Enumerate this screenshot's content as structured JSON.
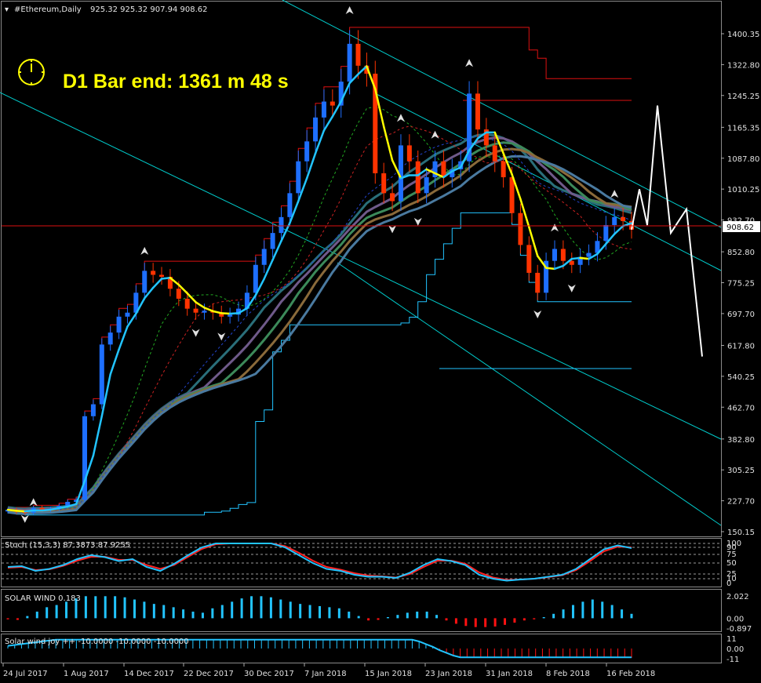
{
  "header": {
    "symbol": "#Ethereum,Daily",
    "ohlc": "925.32 925.32 907.94 908.62"
  },
  "banner": {
    "text": "D1 Bar end: 1361 m 48 s",
    "color": "#ffff00"
  },
  "current_price": "908.62",
  "colors": {
    "background": "#000000",
    "bull": "#1e6fff",
    "bear": "#ff3300",
    "cyan": "#22c4ff",
    "yellow": "#ffff00",
    "channel": "#dd1111",
    "forecast": "#ffffff",
    "trendline": "#00cccc"
  },
  "chart_data": [
    {
      "type": "candlestick",
      "title": "#Ethereum,Daily",
      "price_axis_ticks": [
        "1400.35",
        "1322.80",
        "1245.25",
        "1165.35",
        "1087.80",
        "1010.25",
        "932.70",
        "852.80",
        "775.25",
        "697.70",
        "617.80",
        "540.25",
        "462.70",
        "382.80",
        "305.25",
        "227.70",
        "150.15"
      ],
      "ylim": [
        150.15,
        1400.35
      ],
      "date_ticks": [
        "24 Jul 2017",
        "1 Aug 2017",
        "14 Dec 2017",
        "22 Dec 2017",
        "30 Dec 2017",
        "7 Jan 2018",
        "15 Jan 2018",
        "23 Jan 2018",
        "31 Jan 2018",
        "8 Feb 2018",
        "16 Feb 2018"
      ],
      "close": [
        205,
        200,
        198,
        210,
        205,
        208,
        215,
        225,
        230,
        440,
        470,
        620,
        650,
        690,
        700,
        750,
        805,
        795,
        790,
        760,
        735,
        710,
        700,
        705,
        700,
        690,
        695,
        710,
        750,
        820,
        860,
        900,
        940,
        1000,
        1080,
        1130,
        1190,
        1230,
        1220,
        1280,
        1375,
        1320,
        1300,
        1050,
        1000,
        980,
        1120,
        1080,
        1000,
        1040,
        1080,
        1040,
        1060,
        1080,
        1250,
        1160,
        1120,
        1080,
        1040,
        950,
        870,
        800,
        750,
        830,
        860,
        830,
        820,
        840,
        850,
        880,
        920,
        940,
        930,
        908.62
      ],
      "forecast_path": [
        908.62,
        1010,
        920,
        1220,
        900,
        960,
        590
      ]
    },
    {
      "type": "line",
      "title": "Stoch (15,3,3) 87.3873 87.9255",
      "ticks": [
        "100",
        "90",
        "75",
        "50",
        "25",
        "10",
        "0"
      ],
      "ylim": [
        0,
        100
      ],
      "main": [
        40,
        42,
        30,
        35,
        45,
        60,
        70,
        65,
        55,
        60,
        40,
        30,
        48,
        70,
        90,
        100,
        100,
        100,
        100,
        100,
        90,
        70,
        50,
        35,
        30,
        20,
        15,
        15,
        12,
        25,
        45,
        60,
        55,
        45,
        20,
        10,
        5,
        8,
        10,
        15,
        20,
        35,
        60,
        85,
        95,
        88
      ],
      "signal": [
        38,
        40,
        32,
        34,
        43,
        56,
        66,
        66,
        58,
        58,
        45,
        35,
        45,
        66,
        86,
        98,
        100,
        100,
        100,
        100,
        93,
        76,
        56,
        40,
        33,
        24,
        18,
        16,
        13,
        22,
        40,
        56,
        56,
        48,
        26,
        13,
        7,
        8,
        10,
        14,
        19,
        32,
        55,
        80,
        92,
        90
      ]
    },
    {
      "type": "bar",
      "title": "SOLAR WIND 0.183",
      "ticks": [
        "2.022",
        "0.00",
        "-0.897"
      ],
      "ylim": [
        -0.897,
        2.022
      ],
      "values": [
        -0.1,
        -0.15,
        0.2,
        0.6,
        1.0,
        1.2,
        1.5,
        1.8,
        2.0,
        2.0,
        2.0,
        2.0,
        1.9,
        1.7,
        1.5,
        1.3,
        1.2,
        1.0,
        0.8,
        0.6,
        0.5,
        0.9,
        1.2,
        1.5,
        1.8,
        2.0,
        2.0,
        1.9,
        1.7,
        1.5,
        1.3,
        1.2,
        1.1,
        1.0,
        0.9,
        0.6,
        0.2,
        -0.2,
        -0.15,
        0.1,
        0.3,
        0.5,
        0.6,
        0.6,
        0.3,
        -0.2,
        -0.5,
        -0.7,
        -0.8,
        -0.8,
        -0.75,
        -0.6,
        -0.4,
        -0.2,
        -0.1,
        0.1,
        0.4,
        0.8,
        1.2,
        1.5,
        1.7,
        1.5,
        1.2,
        0.8,
        0.4
      ]
    },
    {
      "type": "bar",
      "title": "Solar wind joy ++ -10.0000 -10.0000 -10.0000",
      "ticks": [
        "11",
        "0.00",
        "-11"
      ],
      "ylim": [
        -11,
        11
      ],
      "values": [
        3,
        4,
        5,
        6,
        7,
        8,
        9,
        10,
        10,
        10,
        10,
        10,
        10,
        10,
        10,
        10,
        10,
        10,
        10,
        10,
        10,
        10,
        10,
        10,
        10,
        10,
        10,
        10,
        10,
        10,
        10,
        10,
        10,
        10,
        10,
        10,
        10,
        10,
        10,
        10,
        10,
        10,
        10,
        10,
        10,
        10,
        10,
        10,
        10,
        10,
        10,
        10,
        10,
        10,
        10,
        10,
        10,
        10,
        10,
        10,
        8,
        5,
        2,
        -2,
        -5,
        -8,
        -10,
        -10,
        -10,
        -10,
        -10,
        -10,
        -10,
        -10,
        -10,
        -10,
        -10,
        -10,
        -10,
        -10,
        -10,
        -10,
        -10,
        -10,
        -10,
        -10,
        -10,
        -10,
        -10,
        -10,
        -10,
        -10
      ]
    }
  ]
}
